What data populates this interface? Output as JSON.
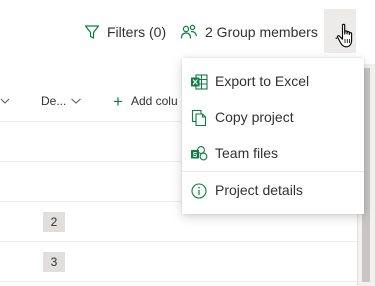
{
  "toolbar": {
    "filters_label": "Filters (0)",
    "group_members_label": "2 Group members",
    "more_label": "···"
  },
  "grid": {
    "columns": [
      {
        "label": ""
      },
      {
        "label": "De..."
      }
    ],
    "add_column_label": "Add colu",
    "rows": [
      {
        "value": ""
      },
      {
        "value": ""
      },
      {
        "value": "2"
      },
      {
        "value": "3"
      }
    ]
  },
  "menu": {
    "items": [
      {
        "label": "Export to Excel",
        "icon": "excel-icon"
      },
      {
        "label": "Copy project",
        "icon": "copy-icon"
      },
      {
        "label": "Team files",
        "icon": "team-files-icon"
      },
      {
        "label": "Project details",
        "icon": "info-icon"
      }
    ]
  },
  "colors": {
    "accent_green": "#107c41",
    "text": "#323130",
    "border": "#edebe9",
    "more_hover_bg": "#edebe9"
  }
}
